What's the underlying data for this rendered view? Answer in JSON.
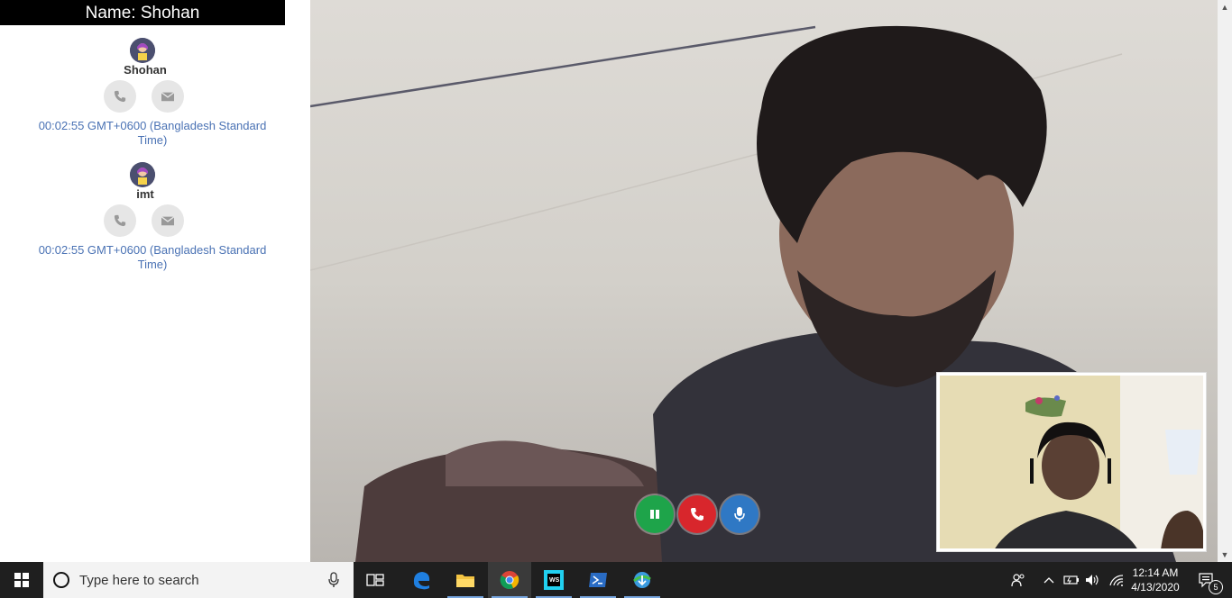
{
  "sidebar": {
    "title": "Name: Shohan",
    "contacts": [
      {
        "name": "Shohan",
        "timestamp": "00:02:55 GMT+0600 (Bangladesh Standard Time)"
      },
      {
        "name": "imt",
        "timestamp": "00:02:55 GMT+0600 (Bangladesh Standard Time)"
      }
    ]
  },
  "controls": {
    "pause_icon": "pause-icon",
    "hangup_icon": "phone-icon",
    "mic_icon": "microphone-icon"
  },
  "taskbar": {
    "search_placeholder": "Type here to search",
    "time": "12:14 AM",
    "date": "4/13/2020",
    "notification_count": "5",
    "apps": [
      "task-view",
      "edge",
      "file-explorer",
      "chrome",
      "webstorm",
      "powershell",
      "internet-download-manager"
    ]
  },
  "colors": {
    "green": "#1ea44a",
    "red": "#d8262c",
    "blue": "#2f78c4",
    "link": "#4a72b4"
  }
}
